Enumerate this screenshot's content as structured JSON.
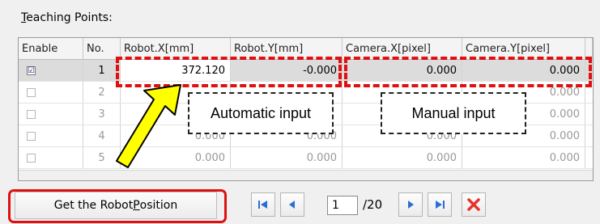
{
  "section_title_prefix": "T",
  "section_title_rest": "eaching Points:",
  "table": {
    "headers": [
      "Enable",
      "No.",
      "Robot.X[mm]",
      "Robot.Y[mm]",
      "Camera.X[pixel]",
      "Camera.Y[pixel]"
    ],
    "rows": [
      {
        "enabled": true,
        "no": "1",
        "robot_x": "372.120",
        "robot_y": "-0.000",
        "camera_x": "0.000",
        "camera_y": "0.000"
      },
      {
        "enabled": false,
        "no": "2",
        "robot_x": "",
        "robot_y": "",
        "camera_x": "",
        "camera_y": "0.000"
      },
      {
        "enabled": false,
        "no": "3",
        "robot_x": "",
        "robot_y": "",
        "camera_x": "",
        "camera_y": "0.000"
      },
      {
        "enabled": false,
        "no": "4",
        "robot_x": "0.000",
        "robot_y": "0.000",
        "camera_x": "0.000",
        "camera_y": "0.000"
      },
      {
        "enabled": false,
        "no": "5",
        "robot_x": "0.000",
        "robot_y": "0.000",
        "camera_x": "0.000",
        "camera_y": "0.000"
      }
    ]
  },
  "annotations": {
    "automatic_label": "Automatic input",
    "manual_label": "Manual input"
  },
  "toolbar": {
    "robot_button_pre": "Get the Robot ",
    "robot_button_key": "P",
    "robot_button_post": "osition",
    "page_value": "1",
    "page_total": "/20"
  },
  "icons": {
    "first": "first-page-icon",
    "prev": "previous-page-icon",
    "next": "next-page-icon",
    "last": "last-page-icon",
    "delete": "delete-icon"
  },
  "colors": {
    "annotation_red": "#e01010",
    "arrow_yellow": "#ffff00",
    "nav_blue": "#2a6fd6",
    "delete_red": "#e8322a"
  }
}
